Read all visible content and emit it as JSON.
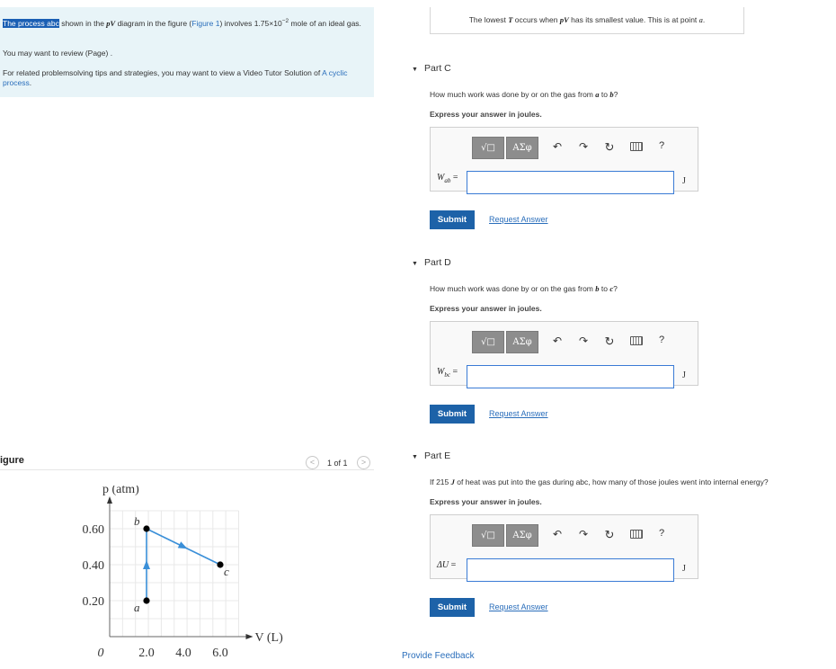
{
  "intro": {
    "highlight": "The process abc",
    "text1": " shown in the ",
    "pV": "pV",
    "text2": " diagram in the figure (",
    "figure_link": "Figure 1",
    "text3": ") involves 1.75×10",
    "exponent": "−2",
    "text4": " mole of an ideal gas.",
    "review_text": "You may want to review (",
    "review_link": "Page",
    "review_end": ") .",
    "related_text": "For related problemsolving tips and strategies, you may want to view a Video Tutor Solution of ",
    "related_link": "A cyclic process",
    "related_end": "."
  },
  "figure": {
    "label": "igure",
    "pager": "1 of 1",
    "prev_icon": "chevron-left-icon",
    "next_icon": "chevron-right-icon"
  },
  "chart_data": {
    "type": "scatter",
    "ylabel": "p (atm)",
    "xlabel": "V (L)",
    "xticks": [
      "2.0",
      "4.0",
      "6.0"
    ],
    "yticks": [
      "0.60",
      "0.40",
      "0.20"
    ],
    "origin_label": "0",
    "xlim": [
      0,
      7.0
    ],
    "ylim": [
      0,
      0.7
    ],
    "grid": true,
    "points": [
      {
        "label": "a",
        "x": 2.0,
        "y": 0.2
      },
      {
        "label": "b",
        "x": 2.0,
        "y": 0.6
      },
      {
        "label": "c",
        "x": 6.0,
        "y": 0.4
      }
    ],
    "path": [
      "a",
      "b",
      "c"
    ],
    "arrow_color": "#3a8fd8",
    "point_color": "#000000"
  },
  "top_note": {
    "text1": "The lowest ",
    "T": "T",
    "text2": " occurs when ",
    "pV": "pV",
    "text3": " has its smallest value. This is at point ",
    "a": "a",
    "text4": "."
  },
  "parts": [
    {
      "title": "Part C",
      "q1": "How much work was done by or on the gas from ",
      "v1": "a",
      "q2": " to ",
      "v2": "b",
      "q3": "?",
      "instruction": "Express your answer in joules.",
      "var_main": "W",
      "var_sub": "ab",
      "equals": " =",
      "unit": "J",
      "value": "",
      "submit": "Submit",
      "request": "Request Answer"
    },
    {
      "title": "Part D",
      "q1": "How much work was done by or on the gas from ",
      "v1": "b",
      "q2": " to ",
      "v2": "c",
      "q3": "?",
      "instruction": "Express your answer in joules.",
      "var_main": "W",
      "var_sub": "bc",
      "equals": " =",
      "unit": "J",
      "value": "",
      "submit": "Submit",
      "request": "Request Answer"
    },
    {
      "title": "Part E",
      "q1": "If 215 ",
      "v1": "J",
      "q2": " of heat was put into the gas during abc, how many of those joules went into internal energy?",
      "v2": "",
      "q3": "",
      "instruction": "Express your answer in joules.",
      "var_main": "ΔU",
      "var_sub": "",
      "equals": " =",
      "unit": "J",
      "value": "",
      "submit": "Submit",
      "request": "Request Answer"
    }
  ],
  "toolbar": {
    "templates_label": "√□",
    "symbols_label": "ΑΣφ",
    "undo_icon": "undo-icon",
    "redo_icon": "redo-icon",
    "reset_icon": "reset-icon",
    "keyboard_icon": "keyboard-icon",
    "help_label": "?"
  },
  "footer": {
    "feedback": "Provide Feedback"
  }
}
